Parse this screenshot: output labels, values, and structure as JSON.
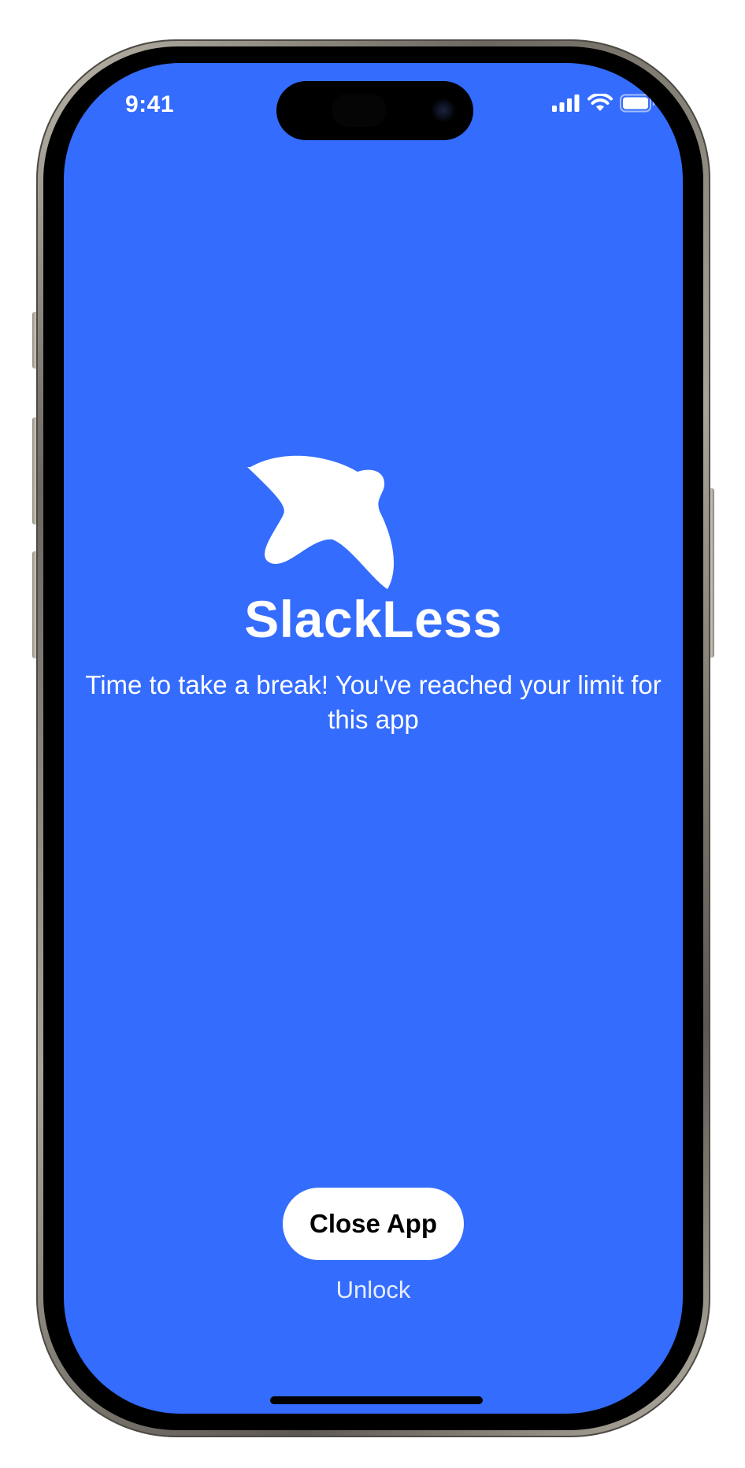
{
  "status_bar": {
    "time": "9:41",
    "icons": [
      "cellular-signal-icon",
      "wifi-icon",
      "battery-icon"
    ]
  },
  "app": {
    "logo_icon": "bird-logo-icon",
    "title": "SlackLess",
    "message": "Time to take a break! You've reached your limit for this app"
  },
  "actions": {
    "close_label": "Close App",
    "unlock_label": "Unlock"
  },
  "colors": {
    "background": "#346cfd",
    "button_background": "#ffffff",
    "button_text": "#000000",
    "text": "#ffffff"
  }
}
